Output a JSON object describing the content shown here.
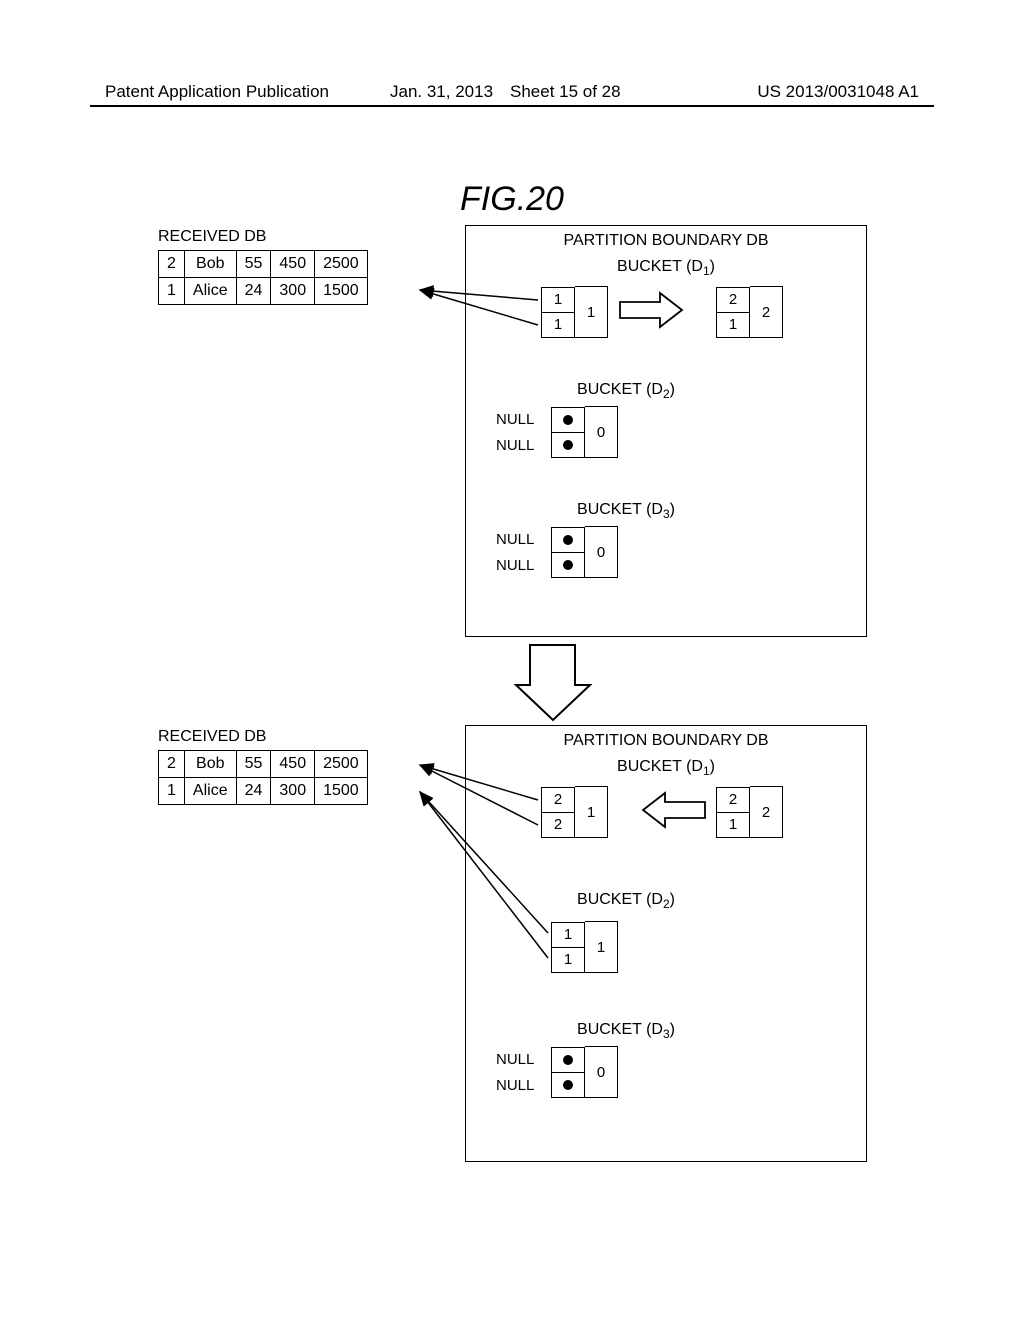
{
  "header": {
    "left": "Patent Application Publication",
    "date": "Jan. 31, 2013",
    "sheet": "Sheet 15 of 28",
    "number": "US 2013/0031048 A1"
  },
  "figure_title": "FIG.20",
  "labels": {
    "received_db": "RECEIVED DB",
    "partition_db": "PARTITION BOUNDARY DB",
    "bucket_prefix": "BUCKET (D",
    "bucket_suffix": ")",
    "null": "NULL"
  },
  "top": {
    "received_db_rows": [
      [
        "2",
        "Bob",
        "55",
        "450",
        "2500"
      ],
      [
        "1",
        "Alice",
        "24",
        "300",
        "1500"
      ]
    ],
    "d1": {
      "left_cells": [
        "1",
        "1"
      ],
      "left_count": "1",
      "right_cells": [
        "2",
        "1"
      ],
      "right_count": "2",
      "arrow_dir": "right"
    },
    "d2": {
      "cells": [
        "dot",
        "dot"
      ],
      "count": "0",
      "null": true
    },
    "d3": {
      "cells": [
        "dot",
        "dot"
      ],
      "count": "0",
      "null": true
    }
  },
  "bottom": {
    "received_db_rows": [
      [
        "2",
        "Bob",
        "55",
        "450",
        "2500"
      ],
      [
        "1",
        "Alice",
        "24",
        "300",
        "1500"
      ]
    ],
    "d1": {
      "left_cells": [
        "2",
        "2"
      ],
      "left_count": "1",
      "right_cells": [
        "2",
        "1"
      ],
      "right_count": "2",
      "arrow_dir": "left"
    },
    "d2": {
      "cells": [
        "1",
        "1"
      ],
      "count": "1",
      "null": false
    },
    "d3": {
      "cells": [
        "dot",
        "dot"
      ],
      "count": "0",
      "null": true
    }
  }
}
